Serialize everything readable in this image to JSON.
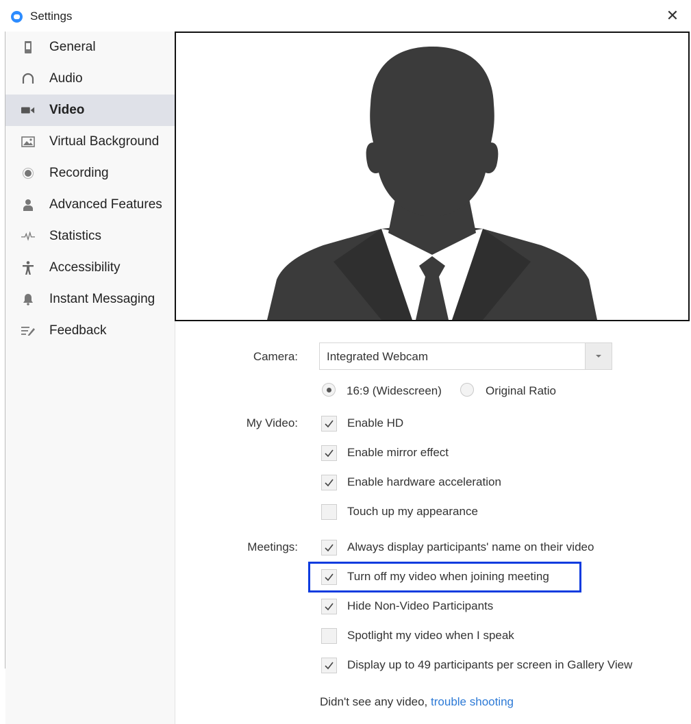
{
  "window": {
    "title": "Settings",
    "close_symbol": "✕"
  },
  "sidebar": {
    "items": [
      {
        "label": "General",
        "icon": "phone-icon"
      },
      {
        "label": "Audio",
        "icon": "headphones-icon"
      },
      {
        "label": "Video",
        "icon": "video-camera-icon",
        "active": true
      },
      {
        "label": "Virtual Background",
        "icon": "image-icon"
      },
      {
        "label": "Recording",
        "icon": "record-icon"
      },
      {
        "label": "Advanced Features",
        "icon": "person-icon"
      },
      {
        "label": "Statistics",
        "icon": "pulse-icon"
      },
      {
        "label": "Accessibility",
        "icon": "accessibility-icon"
      },
      {
        "label": "Instant Messaging",
        "icon": "bell-icon"
      },
      {
        "label": "Feedback",
        "icon": "feedback-icon"
      }
    ]
  },
  "video": {
    "camera_label": "Camera:",
    "camera_value": "Integrated Webcam",
    "ratio_options": [
      {
        "label": "16:9 (Widescreen)",
        "selected": true
      },
      {
        "label": "Original Ratio",
        "selected": false
      }
    ],
    "my_video_label": "My Video:",
    "my_video_options": [
      {
        "label": "Enable HD",
        "checked": true
      },
      {
        "label": "Enable mirror effect",
        "checked": true
      },
      {
        "label": "Enable hardware acceleration",
        "checked": true
      },
      {
        "label": "Touch up my appearance",
        "checked": false
      }
    ],
    "meetings_label": "Meetings:",
    "meetings_options": [
      {
        "label": "Always display participants' name on their video",
        "checked": true
      },
      {
        "label": "Turn off my video when joining meeting",
        "checked": true,
        "highlighted": true
      },
      {
        "label": "Hide Non-Video Participants",
        "checked": true
      },
      {
        "label": "Spotlight my video when I speak",
        "checked": false
      },
      {
        "label": "Display up to 49 participants per screen in Gallery View",
        "checked": true
      }
    ],
    "footer_text": "Didn't see any video,",
    "footer_link": "trouble shooting"
  },
  "colors": {
    "accent": "#2d8cff",
    "link": "#2d7ad6",
    "highlight_border": "#0b3bdf",
    "active_bg": "#dfe1e8"
  }
}
